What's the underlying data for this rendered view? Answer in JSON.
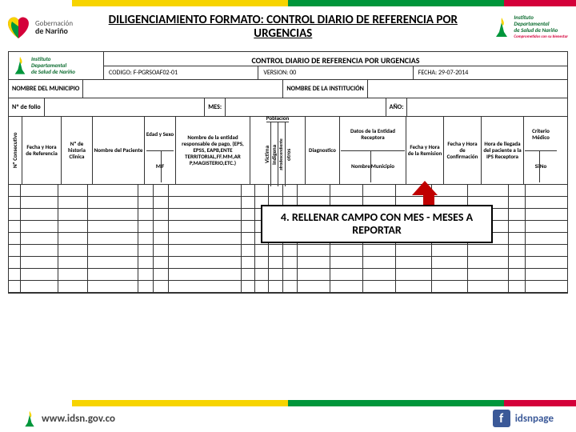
{
  "header": {
    "gob_label": "Gobernación",
    "gob_bold": "de Nariño",
    "title": "DILIGENCIAMIENTO FORMATO: CONTROL DIARIO DE REFERENCIA POR URGENCIAS",
    "idsn_line1": "Instituto",
    "idsn_line2": "Departamental",
    "idsn_line3": "de Salud de Nariño",
    "idsn_tag": "Comprometidos con su bienestar"
  },
  "form": {
    "logo_line1": "Instituto",
    "logo_line2": "Departamental",
    "logo_line3": "de Salud de Nariño",
    "title": "CONTROL DIARIO DE REFERENCIA POR URGENCIAS",
    "codigo_label": "CODIGO: F-PGRSOAF02-01",
    "version_label": "VERSION: 00",
    "fecha_label": "FECHA: 29-07-2014",
    "row1": {
      "municipio": "NOMBRE DEL MUNICIPIO",
      "institucion": "NOMBRE DE LA INSTITUCIÓN"
    },
    "row2": {
      "folio": "Nº de folio",
      "mes": "MES:",
      "ano": "AÑO:"
    }
  },
  "columns": {
    "c0": "Nº Consecutivo",
    "c1": "Fecha y Hora de Referencia",
    "c2": "Nº de historia Clinica",
    "c3": "Nombre del Paciente",
    "c4_top": "Edad y Sexo",
    "c4_m": "M",
    "c4_f": "F",
    "c5": "Nombre de la entidad responsable de pago, (EPS, EPSS, EAPB,ENTE TERRITORIAL,FF.MM,AR P,MAGISTERIO,ETC.)",
    "c6_top": "Poblacion",
    "c6_a": "Victima",
    "c6_b": "Indigena",
    "c6_c": "afrodescendiente",
    "c6_d": "otros",
    "c10": "Diagnostico",
    "c11_top": "Datos de la Entidad Receptora",
    "c11_a": "Nombre",
    "c11_b": "Municipio",
    "c12": "Fecha y Hora de la Remision",
    "c13": "Fecha y Hora de Confirmación",
    "c14": "Hora de llegada del paciente a la IPS Receptora",
    "c15_top": "Criterio Médico",
    "c15_a": "Si",
    "c15_b": "No"
  },
  "callout": "4. RELLENAR CAMPO CON MES - MESES A REPORTAR",
  "footer": {
    "url": "www.idsn.gov.co",
    "fb": "idsnpage"
  }
}
